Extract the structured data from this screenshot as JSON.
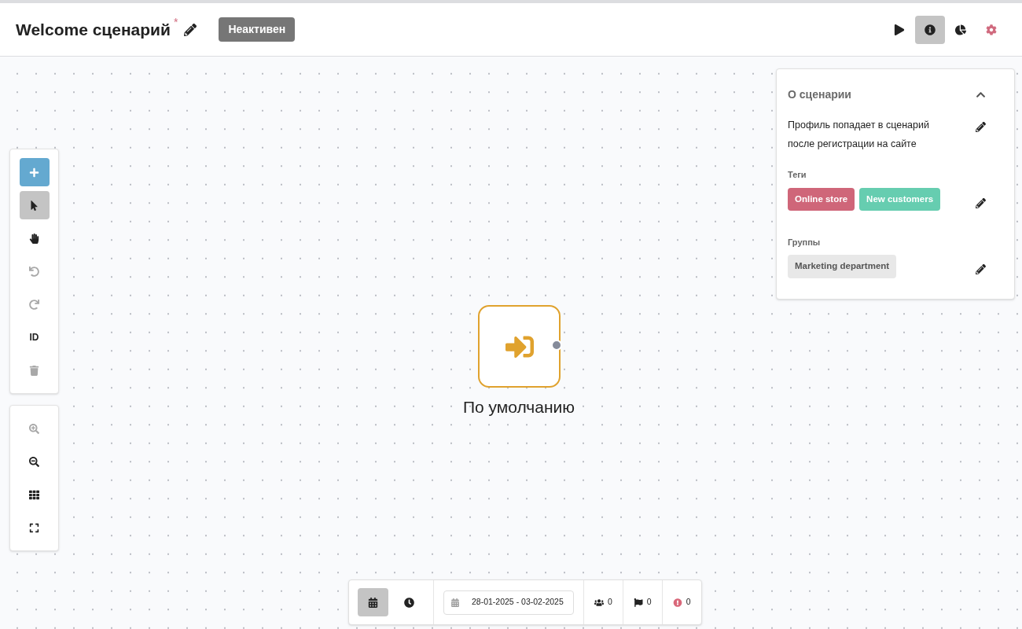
{
  "header": {
    "title": "Welcome сценарий",
    "unsaved_mark": "*",
    "status": "Неактивен",
    "actions": [
      {
        "kind": "play",
        "selected": false
      },
      {
        "kind": "info",
        "selected": true
      },
      {
        "kind": "stats",
        "selected": false
      },
      {
        "kind": "settings",
        "selected": false
      }
    ]
  },
  "tools": [
    {
      "kind": "add"
    },
    {
      "kind": "select",
      "selected": true,
      "disabled": false
    },
    {
      "kind": "pan",
      "selected": false,
      "disabled": false
    },
    {
      "kind": "undo",
      "selected": false,
      "disabled": true
    },
    {
      "kind": "redo",
      "selected": false,
      "disabled": true
    },
    {
      "kind": "id",
      "label": "ID",
      "selected": false,
      "disabled": false
    },
    {
      "kind": "delete",
      "selected": false,
      "disabled": true
    }
  ],
  "zoom_tools": [
    {
      "kind": "zoom_in",
      "disabled": true
    },
    {
      "kind": "zoom_out",
      "disabled": false
    },
    {
      "kind": "grid",
      "disabled": false
    },
    {
      "kind": "fit",
      "disabled": false
    }
  ],
  "node": {
    "label": "По умолчанию"
  },
  "info_panel": {
    "title": "О сценарии",
    "expanded": true,
    "description": "Профиль попадает в сценарий после регистрации на сайте",
    "tags_label": "Теги",
    "tags": [
      {
        "label": "Online store",
        "color": "#cf6679"
      },
      {
        "label": "New customers",
        "color": "#66cdb0"
      }
    ],
    "groups_label": "Группы",
    "groups": [
      "Marketing department"
    ]
  },
  "bottom_bar": {
    "modes": [
      {
        "kind": "calendar",
        "selected": true
      },
      {
        "kind": "clock",
        "selected": false
      }
    ],
    "date_range": "28-01-2025 - 03-02-2025",
    "stats": [
      {
        "kind": "users",
        "value": "0"
      },
      {
        "kind": "flags",
        "value": "0"
      },
      {
        "kind": "errors",
        "value": "0"
      }
    ]
  }
}
